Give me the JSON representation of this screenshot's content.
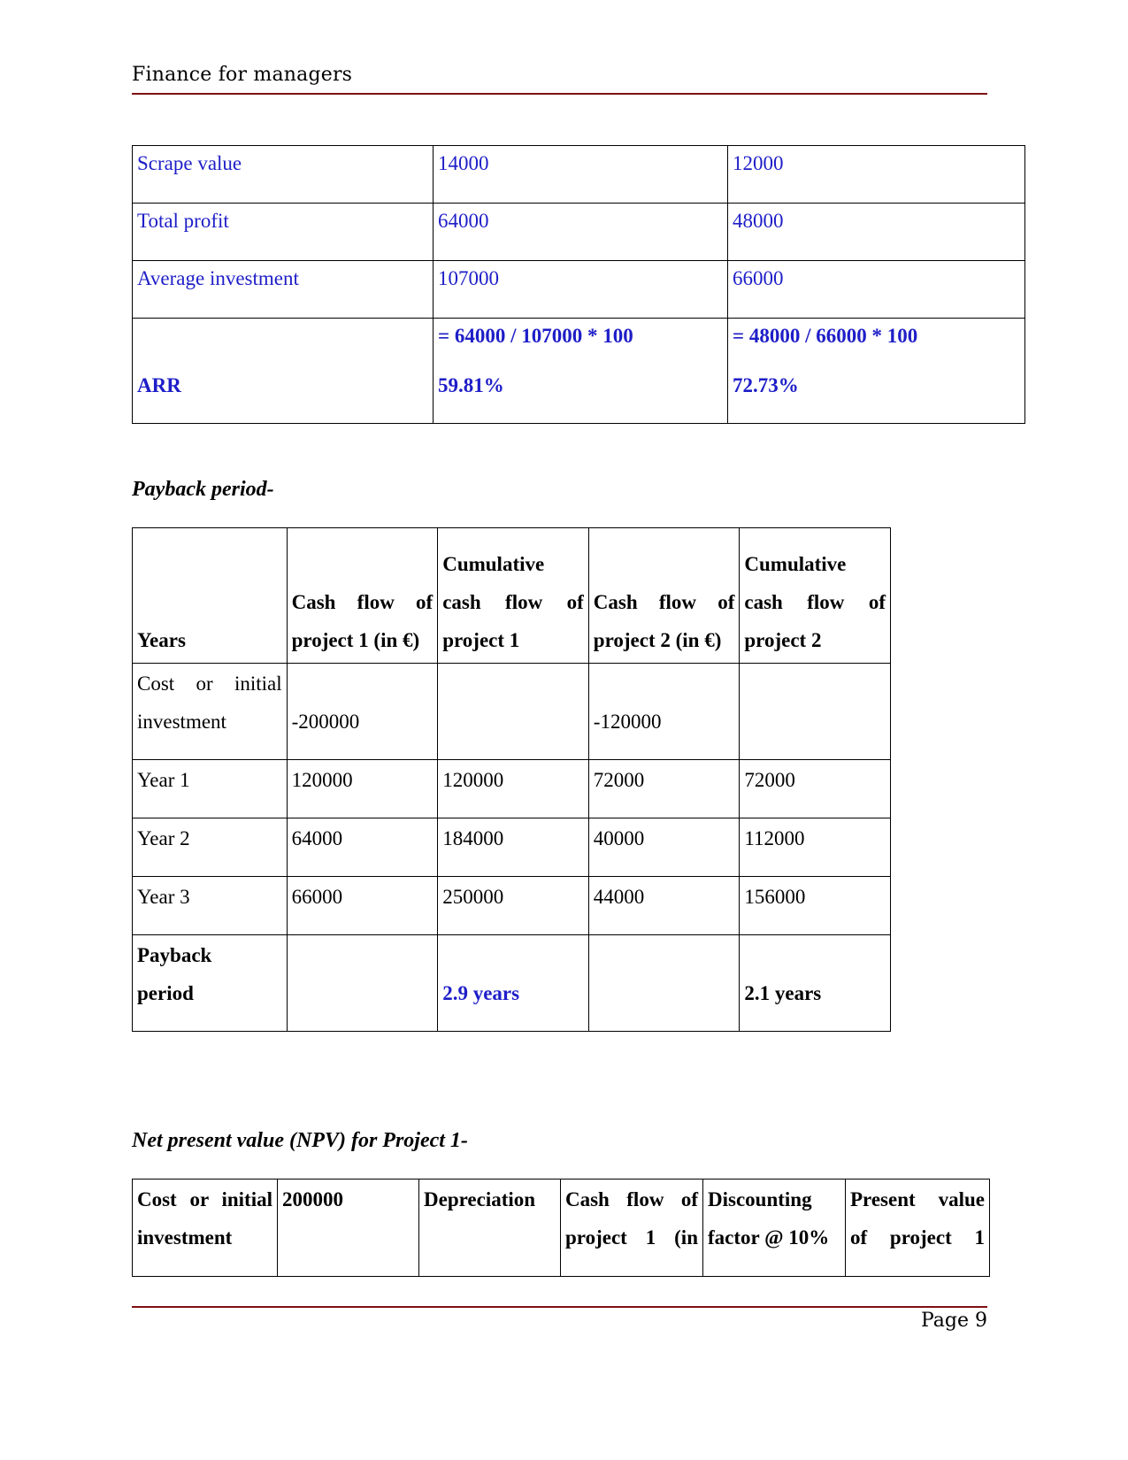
{
  "header": {
    "title": "Finance for managers"
  },
  "footer": {
    "page_label": "Page 9"
  },
  "arr_table": {
    "rows": [
      {
        "label": "Scrape value",
        "project1": "14000",
        "project2": "12000"
      },
      {
        "label": "Total profit",
        "project1": "64000",
        "project2": "48000"
      },
      {
        "label": "Average investment",
        "project1": "107000",
        "project2": "66000"
      }
    ],
    "arr_row": {
      "label": "ARR",
      "project1_formula": "= 64000 / 107000 * 100",
      "project1_result": "59.81%",
      "project2_formula": "= 48000 / 66000 * 100",
      "project2_result": "72.73%"
    }
  },
  "payback_section": {
    "heading": "Payback period-",
    "headers": {
      "years": "Years",
      "cf1_line1": "Cash flow of",
      "cf1_line2": "project 1 (in €)",
      "cum1_line1": "Cumulative",
      "cum1_line2": "cash flow of",
      "cum1_line3": "project 1",
      "cf2_line1": "Cash flow of",
      "cf2_line2": "project 2 (in €)",
      "cum2_line1": "Cumulative",
      "cum2_line2": "cash flow of",
      "cum2_line3": "project 2"
    },
    "cost_row": {
      "label_line1": "Cost or initial",
      "label_line2": "investment",
      "cf1": "-200000",
      "cum1": "",
      "cf2": "-120000",
      "cum2": ""
    },
    "years": [
      {
        "label": "Year 1",
        "cf1": "120000",
        "cum1": "120000",
        "cf2": "72000",
        "cum2": "72000"
      },
      {
        "label": "Year 2",
        "cf1": "64000",
        "cum1": "184000",
        "cf2": "40000",
        "cum2": "112000"
      },
      {
        "label": "Year 3",
        "cf1": "66000",
        "cum1": "250000",
        "cf2": "44000",
        "cum2": "156000"
      }
    ],
    "payback_row": {
      "label_line1": "Payback",
      "label_line2": "period",
      "project1": "2.9 years",
      "project2": "2.1 years"
    }
  },
  "npv_section": {
    "heading": "Net present value (NPV) for Project 1-",
    "header_row": {
      "cost_line1": "Cost or initial",
      "cost_line2": "investment",
      "cost_value": "200000",
      "depreciation": "Depreciation",
      "cashflow_line1": "Cash flow of",
      "cashflow_line2": "project 1 (in",
      "discount_line1": "Discounting",
      "discount_line2": "factor @ 10%",
      "pv_line1": "Present value",
      "pv_line2": "of project 1"
    }
  },
  "colors": {
    "accent_blue": "#1e1ec8",
    "rule_red": "#7f0f14"
  }
}
